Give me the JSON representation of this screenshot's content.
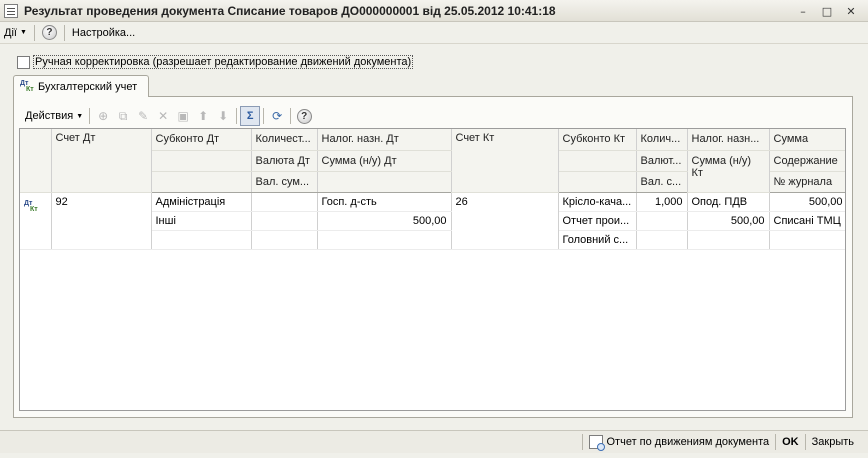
{
  "window": {
    "title": "Результат проведения документа Списание товаров ДО000000001 від 25.05.2012 10:41:18",
    "minimize": "–",
    "maximize": "□",
    "close": "✕"
  },
  "menu": {
    "actions_label": "Дії",
    "help": "?",
    "settings_label": "Настройка..."
  },
  "manual_correction_label": "Ручная корректировка (разрешает редактирование движений документа)",
  "tab_label": "Бухгалтерский учет",
  "toolbar": {
    "actions_label": "Действия",
    "sum_label": "Σ",
    "help": "?"
  },
  "columns": {
    "row1": [
      "Счет Дт",
      "Субконто Дт",
      "Количест...",
      "Налог. назн. Дт",
      "Счет Кт",
      "Субконто Кт",
      "Колич...",
      "Налог. назн...",
      "Сумма"
    ],
    "row2": [
      "Валюта Дт",
      "Сумма (н/у) Дт",
      "Валют...",
      "Сумма (н/у) Кт",
      "Содержание"
    ],
    "row3": [
      "Вал. сум...",
      "Вал. с...",
      "№ журнала"
    ]
  },
  "entries": [
    {
      "account_dt": "92",
      "subconto_dt": [
        "Адміністрація",
        "Інші",
        ""
      ],
      "quantity_dt": "",
      "tax_purpose_dt": "Госп. д-сть",
      "sum_nu_dt": "500,00",
      "account_kt": "26",
      "subconto_kt": [
        "Крісло-кача...",
        "Отчет прои...",
        "Головний с..."
      ],
      "quantity_kt": "1,000",
      "tax_purpose_kt": "Опод. ПДВ",
      "sum_nu_kt": "500,00",
      "amount": "500,00",
      "content": "Списані ТМЦ",
      "journal_no": ""
    }
  ],
  "row_icon": {
    "dt": "Дт",
    "kt": "Кт"
  },
  "status": {
    "report_label": "Отчет по движениям документа",
    "ok_label": "OK",
    "close_label": "Закрыть"
  }
}
